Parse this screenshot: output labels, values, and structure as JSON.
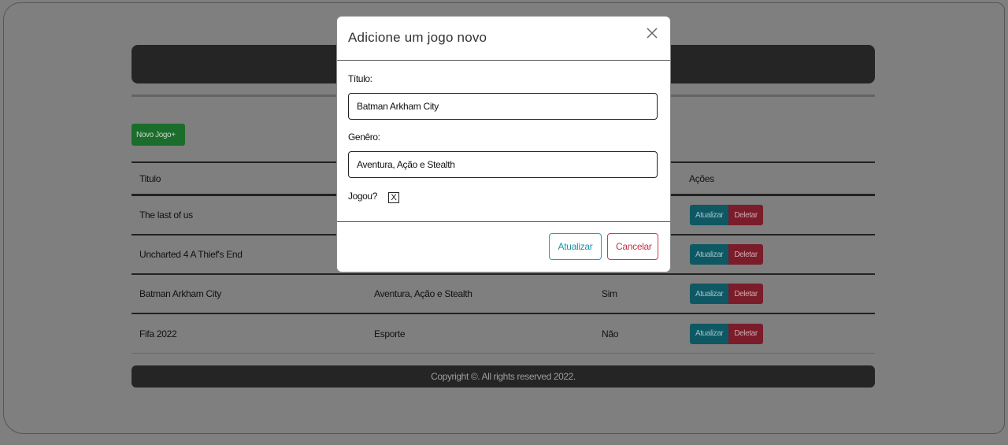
{
  "new_game_button": "Novo Jogo+",
  "table": {
    "headers": {
      "title": "Titulo",
      "actions": "Ações"
    },
    "rows": [
      {
        "title": "The last of us",
        "genre": "",
        "played": ""
      },
      {
        "title": "Uncharted 4 A Thief's End",
        "genre": "",
        "played": ""
      },
      {
        "title": "Batman Arkham City",
        "genre": "Aventura, Ação e Stealth",
        "played": "Sim"
      },
      {
        "title": "Fifa 2022",
        "genre": "Esporte",
        "played": "Não"
      }
    ],
    "update_label": "Atualizar",
    "delete_label": "Deletar"
  },
  "footer": {
    "text": "Copyright ©. All rights reserved 2022."
  },
  "modal": {
    "title": "Adicione um jogo novo",
    "title_label": "Título:",
    "title_value": "Batman Arkham City",
    "genre_label": "Genêro:",
    "genre_value": "Aventura, Ação e Stealth",
    "played_label": "Jogou?",
    "played_checkbox": "X",
    "update_button": "Atualizar",
    "cancel_button": "Cancelar",
    "close_icon": "close-icon"
  },
  "colors": {
    "new_button": "#1b6d2b",
    "update_action": "#0d5863",
    "delete_action": "#7a1c2a",
    "modal_update": "#1aa2b8",
    "modal_cancel": "#d2394c"
  }
}
